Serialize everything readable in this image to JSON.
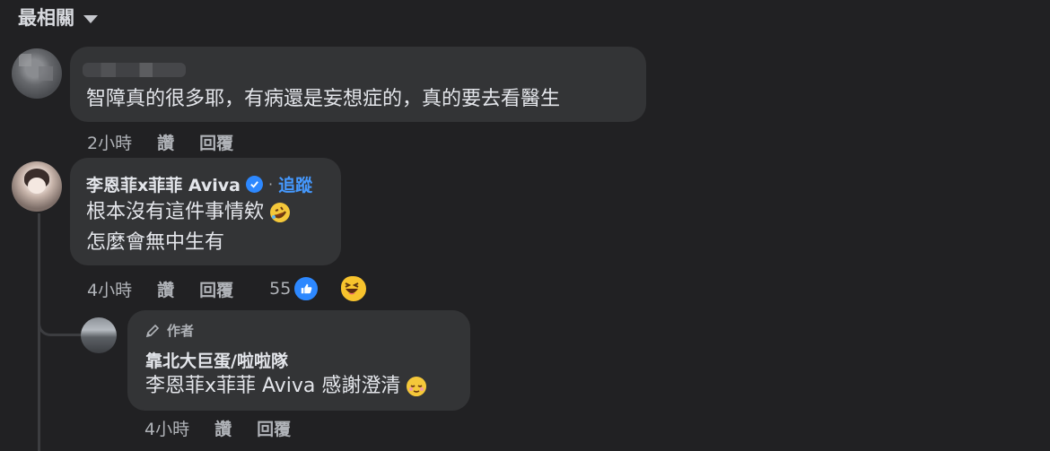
{
  "sort": {
    "label": "最相關"
  },
  "comments": [
    {
      "text": "智障真的很多耶，有病還是妄想症的，真的要去看醫生",
      "time": "2小時",
      "like_label": "讚",
      "reply_label": "回覆"
    },
    {
      "author": "李恩菲x菲菲 Aviva",
      "follow_label": "追蹤",
      "dot": "·",
      "lines": [
        "根本沒有這件事情欸",
        "怎麼會無中生有"
      ],
      "time": "4小時",
      "like_label": "讚",
      "reply_label": "回覆",
      "reaction_count": "55"
    }
  ],
  "reply": {
    "badge": "作者",
    "author": "靠北大巨蛋/啦啦隊",
    "text": "李恩菲x菲菲 Aviva 感謝澄清",
    "time": "4小時",
    "like_label": "讚",
    "reply_label": "回覆"
  },
  "icons": {
    "sort": "chevron-down-icon",
    "verified": "verified-badge-icon",
    "like": "like-reaction-icon",
    "haha": "haha-reaction-icon",
    "laugh_emoji": "rolling-laugh-emoji",
    "relieved_emoji": "relieved-face-emoji",
    "pencil": "pencil-icon"
  },
  "colors": {
    "background": "#212123",
    "bubble": "#333436",
    "accent": "#2d88ff",
    "link": "#4599ff"
  }
}
